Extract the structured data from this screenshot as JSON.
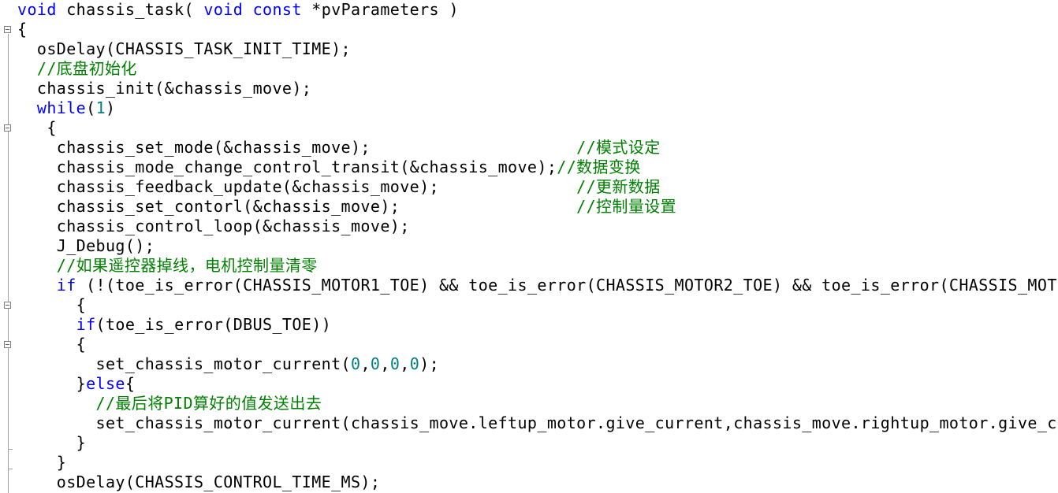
{
  "colors": {
    "keyword": "#0000ff",
    "number": "#008080",
    "comment": "#008000",
    "text": "#000000",
    "background": "#ffffff",
    "fold_marker": "#808080"
  },
  "icons": {
    "fold": "fold-collapse-icon"
  },
  "lines": [
    {
      "parts": [
        {
          "t": "void",
          "c": "kw"
        },
        {
          "t": " chassis_task( ",
          "c": "plain"
        },
        {
          "t": "void",
          "c": "kw"
        },
        {
          "t": " ",
          "c": "plain"
        },
        {
          "t": "const",
          "c": "kw"
        },
        {
          "t": " *pvParameters )",
          "c": "plain"
        }
      ]
    },
    {
      "parts": [
        {
          "t": "{",
          "c": "plain"
        }
      ]
    },
    {
      "parts": [
        {
          "t": "  osDelay(CHASSIS_TASK_INIT_TIME);",
          "c": "plain"
        }
      ]
    },
    {
      "parts": [
        {
          "t": "  //底盘初始化",
          "c": "cm"
        }
      ]
    },
    {
      "parts": [
        {
          "t": "  chassis_init(&chassis_move);",
          "c": "plain"
        }
      ]
    },
    {
      "parts": [
        {
          "t": "  ",
          "c": "plain"
        },
        {
          "t": "while",
          "c": "kw"
        },
        {
          "t": "(",
          "c": "plain"
        },
        {
          "t": "1",
          "c": "num"
        },
        {
          "t": ")",
          "c": "plain"
        }
      ]
    },
    {
      "parts": [
        {
          "t": "   {",
          "c": "plain"
        }
      ]
    },
    {
      "parts": [
        {
          "t": "    chassis_set_mode(&chassis_move);                     ",
          "c": "plain"
        },
        {
          "t": "//模式设定",
          "c": "cm"
        }
      ]
    },
    {
      "parts": [
        {
          "t": "    chassis_mode_change_control_transit(&chassis_move);",
          "c": "plain"
        },
        {
          "t": "//数据变换",
          "c": "cm"
        }
      ]
    },
    {
      "parts": [
        {
          "t": "    chassis_feedback_update(&chassis_move);              ",
          "c": "plain"
        },
        {
          "t": "//更新数据",
          "c": "cm"
        }
      ]
    },
    {
      "parts": [
        {
          "t": "    chassis_set_contorl(&chassis_move);                  ",
          "c": "plain"
        },
        {
          "t": "//控制量设置",
          "c": "cm"
        }
      ]
    },
    {
      "parts": [
        {
          "t": "    chassis_control_loop(&chassis_move);",
          "c": "plain"
        }
      ]
    },
    {
      "parts": [
        {
          "t": "    J_Debug();",
          "c": "plain"
        }
      ]
    },
    {
      "parts": [
        {
          "t": "    //如果遥控器掉线，电机控制量清零",
          "c": "cm"
        }
      ]
    },
    {
      "parts": [
        {
          "t": "    ",
          "c": "plain"
        },
        {
          "t": "if",
          "c": "kw"
        },
        {
          "t": " (!(toe_is_error(CHASSIS_MOTOR1_TOE) && toe_is_error(CHASSIS_MOTOR2_TOE) && toe_is_error(CHASSIS_MOT",
          "c": "plain"
        }
      ]
    },
    {
      "parts": [
        {
          "t": "      {",
          "c": "plain"
        }
      ]
    },
    {
      "parts": [
        {
          "t": "      ",
          "c": "plain"
        },
        {
          "t": "if",
          "c": "kw"
        },
        {
          "t": "(toe_is_error(DBUS_TOE))",
          "c": "plain"
        }
      ]
    },
    {
      "parts": [
        {
          "t": "      {",
          "c": "plain"
        }
      ]
    },
    {
      "parts": [
        {
          "t": "        set_chassis_motor_current(",
          "c": "plain"
        },
        {
          "t": "0",
          "c": "num"
        },
        {
          "t": ",",
          "c": "plain"
        },
        {
          "t": "0",
          "c": "num"
        },
        {
          "t": ",",
          "c": "plain"
        },
        {
          "t": "0",
          "c": "num"
        },
        {
          "t": ",",
          "c": "plain"
        },
        {
          "t": "0",
          "c": "num"
        },
        {
          "t": ");",
          "c": "plain"
        }
      ]
    },
    {
      "parts": [
        {
          "t": "      }",
          "c": "plain"
        },
        {
          "t": "else",
          "c": "kw"
        },
        {
          "t": "{",
          "c": "plain"
        }
      ]
    },
    {
      "parts": [
        {
          "t": "        //最后将PID算好的值发送出去",
          "c": "cm"
        }
      ]
    },
    {
      "parts": [
        {
          "t": "        set_chassis_motor_current(chassis_move.leftup_motor.give_current,chassis_move.rightup_motor.give_c",
          "c": "plain"
        }
      ]
    },
    {
      "parts": [
        {
          "t": "      }",
          "c": "plain"
        }
      ]
    },
    {
      "parts": [
        {
          "t": "    }",
          "c": "plain"
        }
      ]
    },
    {
      "parts": [
        {
          "t": "    osDelay(CHASSIS_CONTROL_TIME_MS);",
          "c": "plain"
        }
      ]
    }
  ]
}
